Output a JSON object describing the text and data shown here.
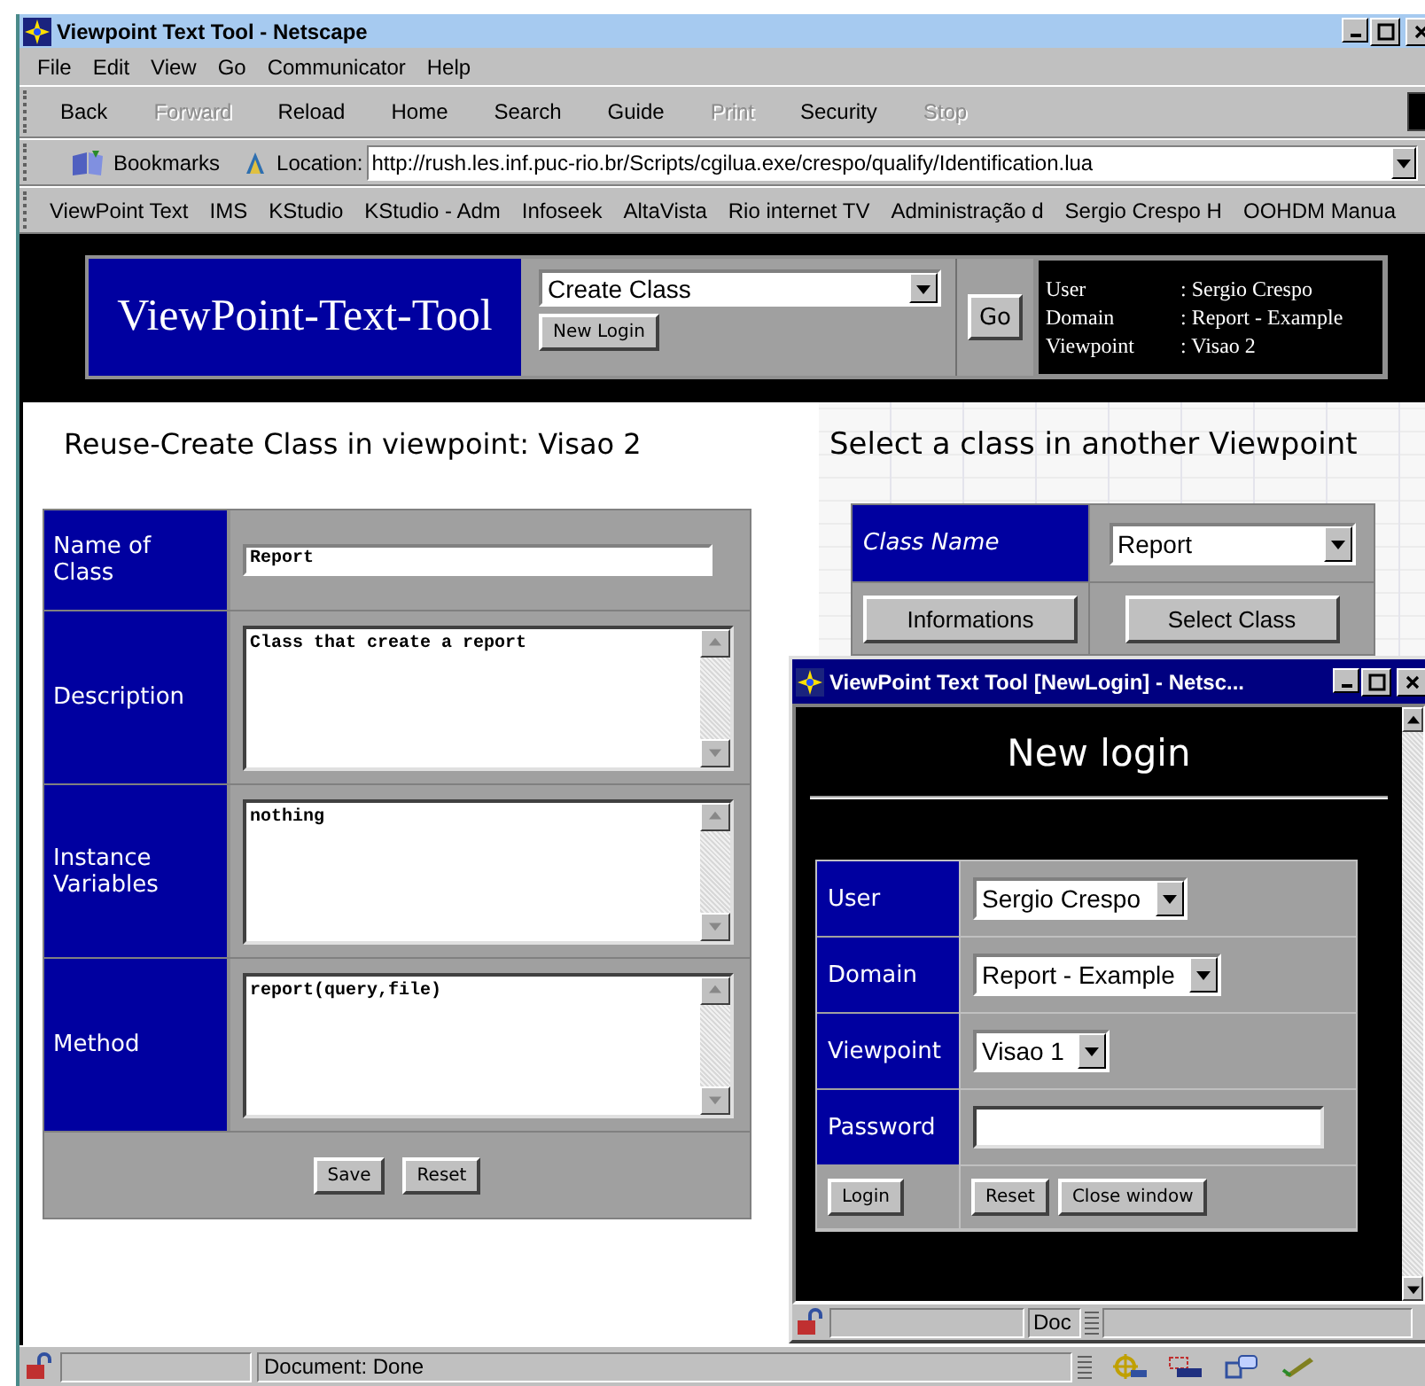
{
  "window": {
    "title": "Viewpoint Text Tool - Netscape",
    "menu": [
      "File",
      "Edit",
      "View",
      "Go",
      "Communicator",
      "Help"
    ],
    "navigation": [
      {
        "label": "Back",
        "disabled": false
      },
      {
        "label": "Forward",
        "disabled": true
      },
      {
        "label": "Reload",
        "disabled": false
      },
      {
        "label": "Home",
        "disabled": false
      },
      {
        "label": "Search",
        "disabled": false
      },
      {
        "label": "Guide",
        "disabled": false
      },
      {
        "label": "Print",
        "disabled": true
      },
      {
        "label": "Security",
        "disabled": false
      },
      {
        "label": "Stop",
        "disabled": true
      }
    ],
    "bookmarks_label": "Bookmarks",
    "location_label": "Location:",
    "location": "http://rush.les.inf.puc-rio.br/Scripts/cgilua.exe/crespo/qualify/Identification.lua",
    "personal_toolbar": [
      "ViewPoint Text",
      "IMS",
      "KStudio",
      "KStudio - Adm",
      "Infoseek",
      "AltaVista",
      "Rio internet TV",
      "Administração d",
      "Sergio Crespo H",
      "OOHDM Manua"
    ]
  },
  "header": {
    "logo": "ViewPoint-Text-Tool",
    "action": "Create Class",
    "new_login": "New Login",
    "go": "Go",
    "session": [
      {
        "label": "User",
        "value": ": Sergio Crespo"
      },
      {
        "label": "Domain",
        "value": ": Report - Example"
      },
      {
        "label": "Viewpoint",
        "value": ": Visao 2"
      }
    ]
  },
  "class_form": {
    "title": "Reuse-Create Class in viewpoint: Visao 2",
    "rows": [
      {
        "label": "Name of Class",
        "kind": "input",
        "value": "Report"
      },
      {
        "label": "Description",
        "kind": "textarea",
        "value": "Class that create a report"
      },
      {
        "label": "Instance Variables",
        "kind": "textarea",
        "value": "nothing"
      },
      {
        "label": "Method",
        "kind": "textarea",
        "value": "report(query,file)"
      }
    ],
    "buttons": [
      "Save",
      "Reset"
    ]
  },
  "class_picker": {
    "title": "Select a class in another Viewpoint",
    "label": "Class Name",
    "value": "Report",
    "buttons": [
      "Informations",
      "Select Class"
    ]
  },
  "popup": {
    "title": "ViewPoint Text Tool [NewLogin] - Netsc...",
    "heading": "New login",
    "rows": [
      {
        "label": "User",
        "kind": "select",
        "value": "Sergio Crespo"
      },
      {
        "label": "Domain",
        "kind": "select",
        "value": "Report - Example"
      },
      {
        "label": "Viewpoint",
        "kind": "select",
        "value": "Visao 1"
      },
      {
        "label": "Password",
        "kind": "password"
      }
    ],
    "login_button": "Login",
    "buttons": [
      "Reset",
      "Close window"
    ],
    "status": "Doc"
  },
  "status_bar": {
    "text": "Document: Done"
  }
}
